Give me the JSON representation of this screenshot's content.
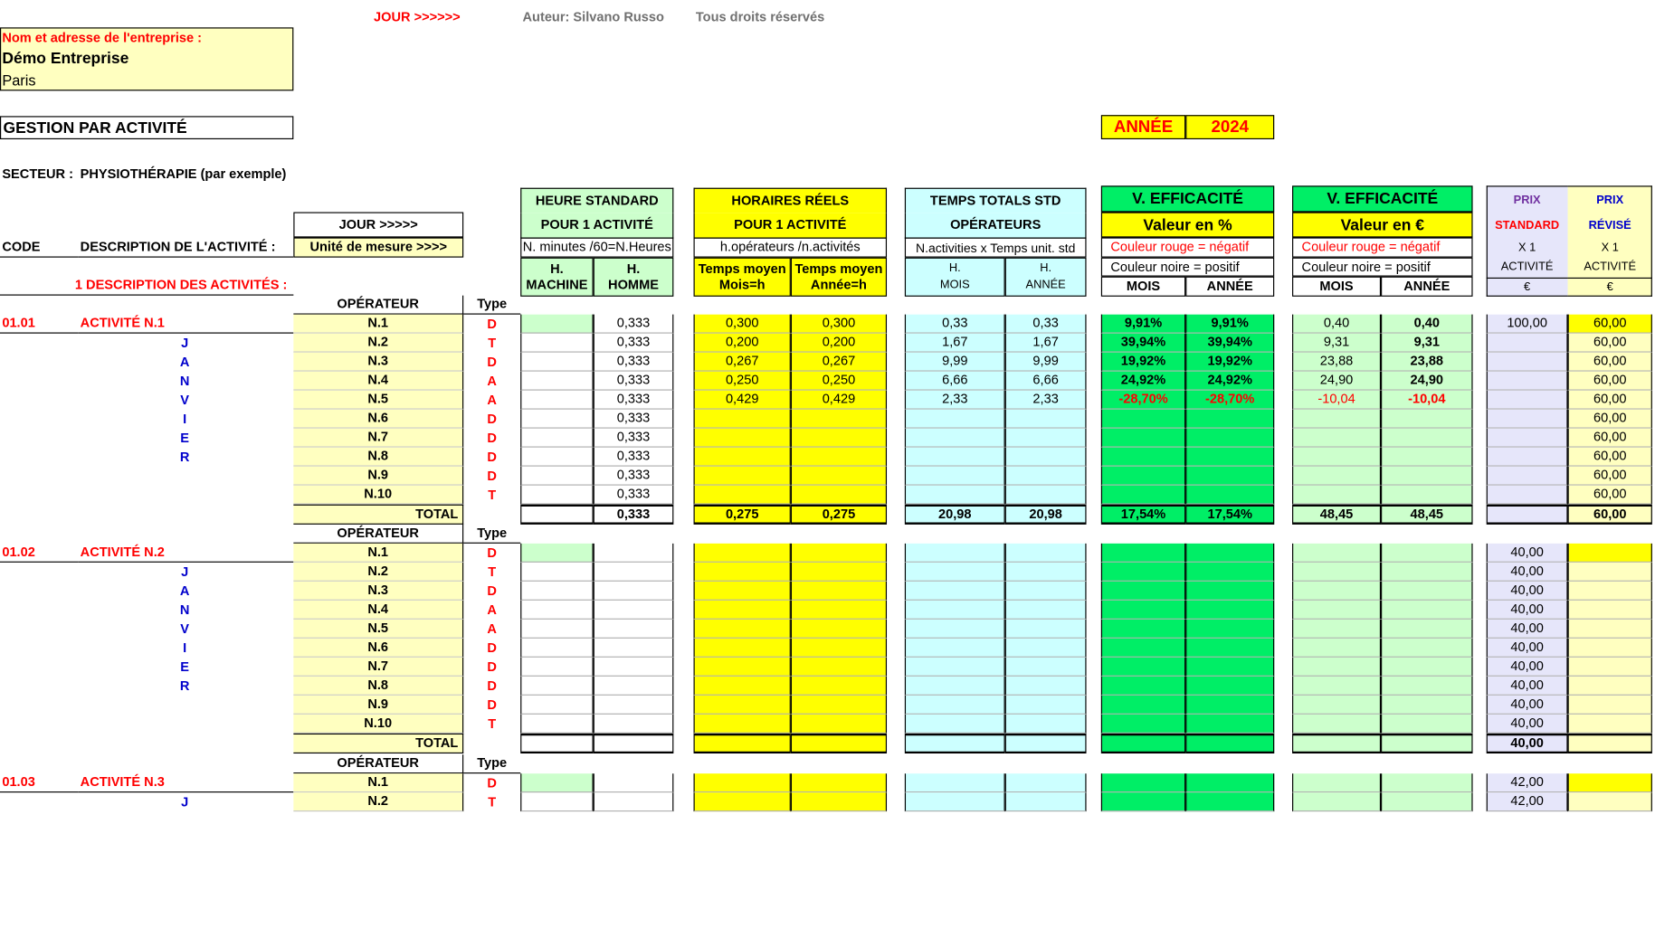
{
  "header": {
    "jour_top": "JOUR >>>>>>",
    "author": "Auteur: Silvano Russo",
    "rights": "Tous droits réservés",
    "company_label": "Nom et adresse de l'entreprise :",
    "company_name": "Démo Entreprise",
    "company_city": "Paris",
    "title": "GESTION PAR ACTIVITÉ",
    "annee_label": "ANNÉE",
    "annee_value": "2024",
    "secteur_label": "SECTEUR :",
    "secteur_value": "PHYSIOTHÉRAPIE (par exemple)"
  },
  "columns": {
    "jour": "JOUR >>>>>",
    "code": "CODE",
    "description": "DESCRIPTION DE L'ACTIVITÉ :",
    "unite": "Unité de mesure >>>>",
    "desc_activites": "1 DESCRIPTION DES ACTIVITÉS :",
    "std_h1": "HEURE STANDARD",
    "std_h2": "POUR 1 ACTIVITÉ",
    "std_note": "N. minutes /60=N.Heures",
    "std_c1a": "H.",
    "std_c1b": "MACHINE",
    "std_c2a": "H.",
    "std_c2b": "HOMME",
    "reel_h1": "HORAIRES RÉELS",
    "reel_h2": "POUR 1 ACTIVITÉ",
    "reel_note": "h.opérateurs /n.activités",
    "reel_c1a": "Temps moyen",
    "reel_c1b": "Mois=h",
    "reel_c2a": "Temps moyen",
    "reel_c2b": "Année=h",
    "tt_h1": "TEMPS TOTALS STD",
    "tt_h2": "OPÉRATEURS",
    "tt_note": "N.activities x Temps unit. std",
    "tt_c1a": "H.",
    "tt_c1b": "MOIS",
    "tt_c2a": "H.",
    "tt_c2b": "ANNÉE",
    "ve_h1": "V. EFFICACITÉ",
    "ve_pct": "Valeur en %",
    "ve_eur": "Valeur en €",
    "neg_note": "Couleur rouge = négatif",
    "pos_note": "Couleur noire = positif",
    "mois": "MOIS",
    "annee": "ANNÉE",
    "prix": "PRIX",
    "standard": "STANDARD",
    "revise": "RÉVISÉ",
    "x1": "X 1",
    "activite": "ACTIVITÉ",
    "euro": "€",
    "operateur": "OPÉRATEUR",
    "type": "Type",
    "total": "TOTAL"
  },
  "month_letters": [
    "J",
    "A",
    "N",
    "V",
    "I",
    "E",
    "R"
  ],
  "blocks": [
    {
      "code": "01.01",
      "name": "ACTIVITÉ N.1",
      "rows": [
        {
          "op": "N.1",
          "type": "D",
          "homme": "0,333",
          "rm": "0,300",
          "ra": "0,300",
          "tm": "0,33",
          "ta": "0,33",
          "pm": "9,91%",
          "pa": "9,91%",
          "em": "0,40",
          "ea": "0,40",
          "ps": "100,00",
          "pr": "60,00"
        },
        {
          "op": "N.2",
          "type": "T",
          "homme": "0,333",
          "rm": "0,200",
          "ra": "0,200",
          "tm": "1,67",
          "ta": "1,67",
          "pm": "39,94%",
          "pa": "39,94%",
          "em": "9,31",
          "ea": "9,31",
          "ps": "",
          "pr": "60,00"
        },
        {
          "op": "N.3",
          "type": "D",
          "homme": "0,333",
          "rm": "0,267",
          "ra": "0,267",
          "tm": "9,99",
          "ta": "9,99",
          "pm": "19,92%",
          "pa": "19,92%",
          "em": "23,88",
          "ea": "23,88",
          "ps": "",
          "pr": "60,00"
        },
        {
          "op": "N.4",
          "type": "A",
          "homme": "0,333",
          "rm": "0,250",
          "ra": "0,250",
          "tm": "6,66",
          "ta": "6,66",
          "pm": "24,92%",
          "pa": "24,92%",
          "em": "24,90",
          "ea": "24,90",
          "ps": "",
          "pr": "60,00"
        },
        {
          "op": "N.5",
          "type": "A",
          "homme": "0,333",
          "rm": "0,429",
          "ra": "0,429",
          "tm": "2,33",
          "ta": "2,33",
          "pm": "-28,70%",
          "pa": "-28,70%",
          "em": "-10,04",
          "ea": "-10,04",
          "ps": "",
          "pr": "60,00",
          "neg": true
        },
        {
          "op": "N.6",
          "type": "D",
          "homme": "0,333",
          "rm": "",
          "ra": "",
          "tm": "",
          "ta": "",
          "pm": "",
          "pa": "",
          "em": "",
          "ea": "",
          "ps": "",
          "pr": "60,00"
        },
        {
          "op": "N.7",
          "type": "D",
          "homme": "0,333",
          "rm": "",
          "ra": "",
          "tm": "",
          "ta": "",
          "pm": "",
          "pa": "",
          "em": "",
          "ea": "",
          "ps": "",
          "pr": "60,00"
        },
        {
          "op": "N.8",
          "type": "D",
          "homme": "0,333",
          "rm": "",
          "ra": "",
          "tm": "",
          "ta": "",
          "pm": "",
          "pa": "",
          "em": "",
          "ea": "",
          "ps": "",
          "pr": "60,00"
        },
        {
          "op": "N.9",
          "type": "D",
          "homme": "0,333",
          "rm": "",
          "ra": "",
          "tm": "",
          "ta": "",
          "pm": "",
          "pa": "",
          "em": "",
          "ea": "",
          "ps": "",
          "pr": "60,00"
        },
        {
          "op": "N.10",
          "type": "T",
          "homme": "0,333",
          "rm": "",
          "ra": "",
          "tm": "",
          "ta": "",
          "pm": "",
          "pa": "",
          "em": "",
          "ea": "",
          "ps": "",
          "pr": "60,00"
        }
      ],
      "total": {
        "homme": "0,333",
        "rm": "0,275",
        "ra": "0,275",
        "tm": "20,98",
        "ta": "20,98",
        "pm": "17,54%",
        "pa": "17,54%",
        "em": "48,45",
        "ea": "48,45",
        "pr": "60,00"
      }
    },
    {
      "code": "01.02",
      "name": "ACTIVITÉ N.2",
      "rows": [
        {
          "op": "N.1",
          "type": "D",
          "ps": "40,00"
        },
        {
          "op": "N.2",
          "type": "T",
          "ps": "40,00"
        },
        {
          "op": "N.3",
          "type": "D",
          "ps": "40,00"
        },
        {
          "op": "N.4",
          "type": "A",
          "ps": "40,00"
        },
        {
          "op": "N.5",
          "type": "A",
          "ps": "40,00"
        },
        {
          "op": "N.6",
          "type": "D",
          "ps": "40,00"
        },
        {
          "op": "N.7",
          "type": "D",
          "ps": "40,00"
        },
        {
          "op": "N.8",
          "type": "D",
          "ps": "40,00"
        },
        {
          "op": "N.9",
          "type": "D",
          "ps": "40,00"
        },
        {
          "op": "N.10",
          "type": "T",
          "ps": "40,00"
        }
      ],
      "total": {
        "ps": "40,00"
      }
    },
    {
      "code": "01.03",
      "name": "ACTIVITÉ N.3",
      "rows": [
        {
          "op": "N.1",
          "type": "D",
          "ps": "42,00"
        },
        {
          "op": "N.2",
          "type": "T",
          "ps": "42,00"
        }
      ]
    }
  ]
}
